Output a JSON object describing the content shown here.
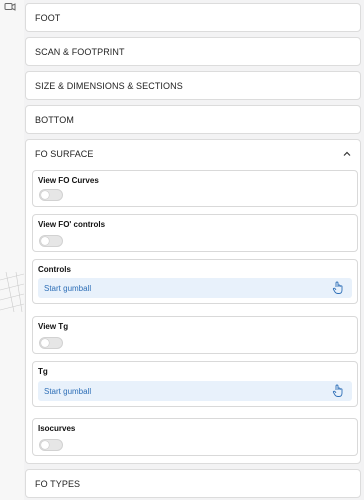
{
  "sections": {
    "foot": "FOOT",
    "scan": "SCAN & FOOTPRINT",
    "size": "SIZE & DIMENSIONS & SECTIONS",
    "bottom": "BOTTOM",
    "fo_surface": "FO SURFACE",
    "fo_types": "FO TYPES"
  },
  "fo_surface": {
    "view_fo_curves": {
      "label": "View FO Curves",
      "on": false
    },
    "view_fo_controls": {
      "label": "View FO' controls",
      "on": false
    },
    "controls": {
      "label": "Controls",
      "button": "Start gumball"
    },
    "view_tg": {
      "label": "View Tg",
      "on": false
    },
    "tg": {
      "label": "Tg",
      "button": "Start gumball"
    },
    "isocurves": {
      "label": "Isocurves",
      "on": false
    }
  },
  "colors": {
    "accent_text": "#2e6fb7",
    "accent_bg": "#e8f1fb"
  },
  "icons": {
    "chevron": "chevron-up-icon",
    "pointer": "hand-pointer-icon",
    "window": "window-icon"
  }
}
